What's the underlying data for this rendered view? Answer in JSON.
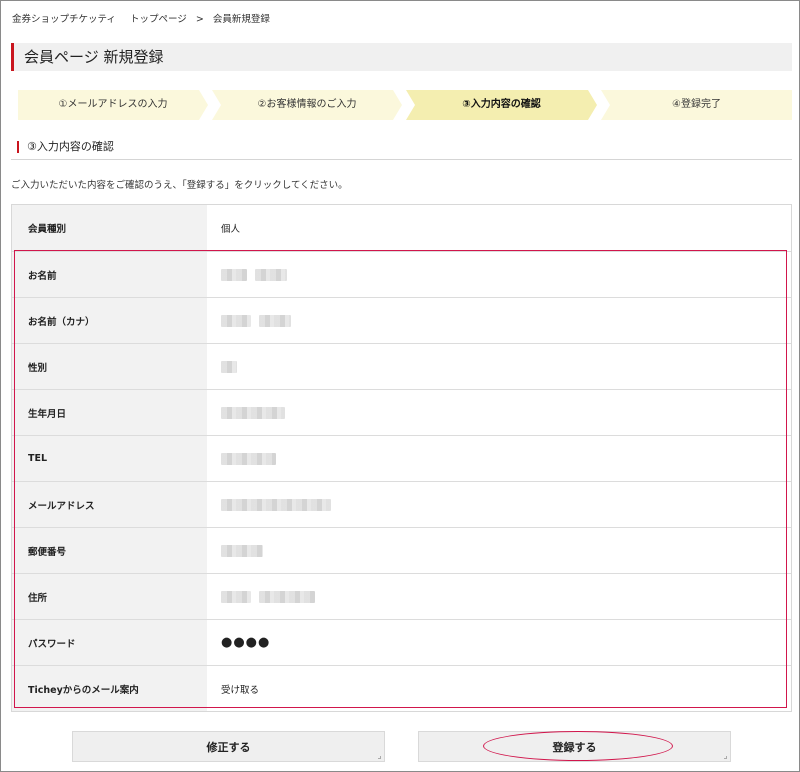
{
  "breadcrumb": {
    "site": "金券ショップチケッティ",
    "top": "トップページ",
    "separator": ">",
    "current": "会員新規登録"
  },
  "page_title": "会員ページ 新規登録",
  "steps": [
    {
      "label": "①メールアドレスの入力",
      "state": "done"
    },
    {
      "label": "②お客様情報のご入力",
      "state": "done"
    },
    {
      "label": "③入力内容の確認",
      "state": "active"
    },
    {
      "label": "④登録完了",
      "state": "todo"
    }
  ],
  "section_title": "③入力内容の確認",
  "intro": "ご入力いただいた内容をご確認のうえ、「登録する」をクリックしてください。",
  "rows": [
    {
      "label": "会員種別",
      "value": "個人"
    },
    {
      "label": "お名前",
      "value": ""
    },
    {
      "label": "お名前（カナ）",
      "value": ""
    },
    {
      "label": "性別",
      "value": ""
    },
    {
      "label": "生年月日",
      "value": ""
    },
    {
      "label": "TEL",
      "value": ""
    },
    {
      "label": "メールアドレス",
      "value": ""
    },
    {
      "label": "郵便番号",
      "value": ""
    },
    {
      "label": "住所",
      "value": ""
    },
    {
      "label": "パスワード",
      "value": "●●●●"
    },
    {
      "label": "Ticheyからのメール案内",
      "value": "受け取る"
    }
  ],
  "buttons": {
    "edit": "修正する",
    "submit": "登録する"
  },
  "colors": {
    "accent": "#c9151e",
    "highlight": "#d1164c",
    "step_active": "#f4eeb0",
    "step_inactive": "#fbf8dc"
  }
}
